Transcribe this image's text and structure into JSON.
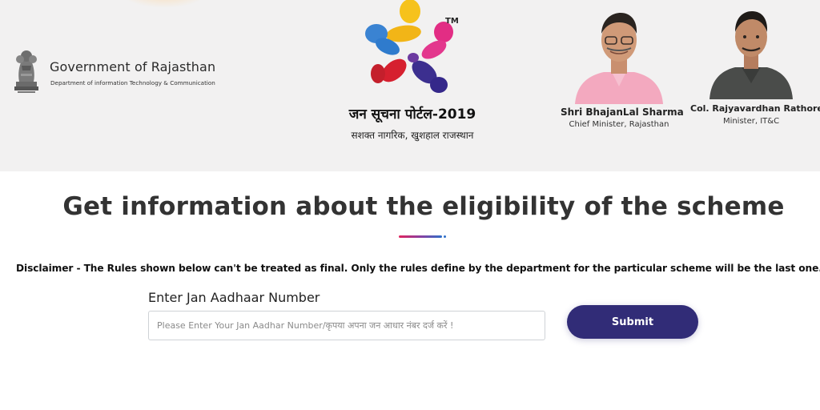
{
  "header": {
    "government": {
      "title": "Government of Rajasthan",
      "department": "Department of information Technology & Communication"
    },
    "portal": {
      "trademark": "TM",
      "title": "जन सूचना पोर्टल-2019",
      "tagline": "सशक्त नागरिक, खुशहाल राजस्थान"
    },
    "officials": [
      {
        "name": "Shri BhajanLal Sharma",
        "role": "Chief Minister, Rajasthan"
      },
      {
        "name": "Col. Rajyavardhan Rathore",
        "role": "Minister, IT&C"
      }
    ]
  },
  "main": {
    "heading": "Get information about the eligibility of the scheme",
    "disclaimer": "Disclaimer - The Rules shown below can't be treated as final. Only the rules define by the department for the particular scheme will be the last one.",
    "form": {
      "label": "Enter Jan Aadhaar Number",
      "input_value": "",
      "placeholder": "Please Enter Your Jan Aadhar Number/कृपया अपना जन आधार नंबर दर्ज करें !",
      "submit_label": "Submit"
    }
  },
  "colors": {
    "header_bg": "#f2f1f1",
    "button_bg": "#312c77",
    "heading_text": "#333333",
    "divider_gradient": [
      "#e0245e",
      "#8a3fa0",
      "#2f6fc8"
    ]
  },
  "icons": {
    "emblem": "state-emblem-icon",
    "portal_logo": "jan-soochna-portal-logo"
  }
}
